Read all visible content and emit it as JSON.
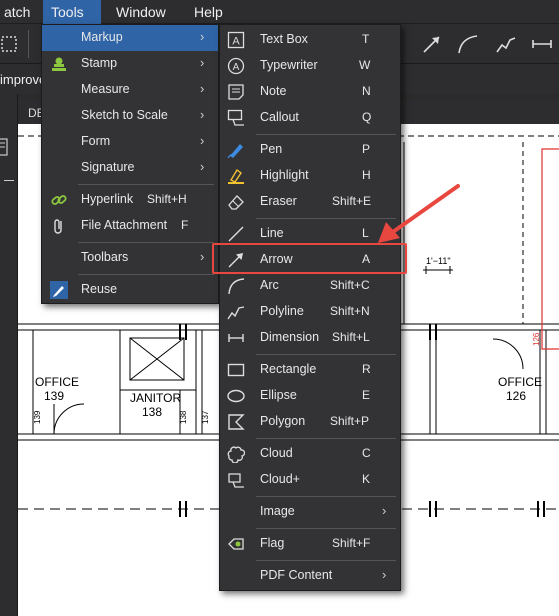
{
  "menubar": {
    "items": [
      {
        "label": "atch"
      },
      {
        "label": "Tools"
      },
      {
        "label": "Window"
      },
      {
        "label": "Help"
      }
    ]
  },
  "tab_text": "improvem",
  "doc_tab_text": "DE",
  "drawing": {
    "rooms": [
      {
        "name": "OFFICE",
        "number": "139"
      },
      {
        "name": "JANITOR",
        "number": "138"
      },
      {
        "name": "OFFICE",
        "number": "126"
      }
    ],
    "door_numbers": [
      "139",
      "138",
      "137",
      "126"
    ],
    "dimension": "1'−11\""
  },
  "tools_menu": {
    "items": [
      {
        "label": "Markup",
        "shortcut": "",
        "icon": "markup-icon",
        "submenu": true,
        "highlighted": true
      },
      {
        "label": "Stamp",
        "shortcut": "",
        "icon": "stamp-icon",
        "submenu": true
      },
      {
        "label": "Measure",
        "shortcut": "",
        "icon": "",
        "submenu": true
      },
      {
        "label": "Sketch to Scale",
        "shortcut": "",
        "icon": "",
        "submenu": true
      },
      {
        "label": "Form",
        "shortcut": "",
        "icon": "",
        "submenu": true
      },
      {
        "label": "Signature",
        "shortcut": "",
        "icon": "",
        "submenu": true
      },
      {
        "label": "Hyperlink",
        "shortcut": "Shift+H",
        "icon": "hyperlink-icon",
        "submenu": false
      },
      {
        "label": "File Attachment",
        "shortcut": "F",
        "icon": "paperclip-icon",
        "submenu": false
      },
      {
        "label": "Toolbars",
        "shortcut": "",
        "icon": "",
        "submenu": true
      },
      {
        "label": "Reuse",
        "shortcut": "",
        "icon": "reuse-icon",
        "submenu": false
      }
    ]
  },
  "markup_menu": {
    "items": [
      {
        "label": "Text Box",
        "shortcut": "T",
        "icon": "text-box-icon"
      },
      {
        "label": "Typewriter",
        "shortcut": "W",
        "icon": "typewriter-icon"
      },
      {
        "label": "Note",
        "shortcut": "N",
        "icon": "note-icon"
      },
      {
        "label": "Callout",
        "shortcut": "Q",
        "icon": "callout-icon"
      },
      {
        "label": "Pen",
        "shortcut": "P",
        "icon": "pen-icon"
      },
      {
        "label": "Highlight",
        "shortcut": "H",
        "icon": "highlight-icon"
      },
      {
        "label": "Eraser",
        "shortcut": "Shift+E",
        "icon": "eraser-icon"
      },
      {
        "label": "Line",
        "shortcut": "L",
        "icon": "line-icon"
      },
      {
        "label": "Arrow",
        "shortcut": "A",
        "icon": "arrow-icon"
      },
      {
        "label": "Arc",
        "shortcut": "Shift+C",
        "icon": "arc-icon"
      },
      {
        "label": "Polyline",
        "shortcut": "Shift+N",
        "icon": "polyline-icon"
      },
      {
        "label": "Dimension",
        "shortcut": "Shift+L",
        "icon": "dimension-icon"
      },
      {
        "label": "Rectangle",
        "shortcut": "R",
        "icon": "rectangle-icon"
      },
      {
        "label": "Ellipse",
        "shortcut": "E",
        "icon": "ellipse-icon"
      },
      {
        "label": "Polygon",
        "shortcut": "Shift+P",
        "icon": "polygon-icon"
      },
      {
        "label": "Cloud",
        "shortcut": "C",
        "icon": "cloud-icon"
      },
      {
        "label": "Cloud+",
        "shortcut": "K",
        "icon": "cloud-plus-icon"
      },
      {
        "label": "Image",
        "shortcut": "",
        "icon": "",
        "submenu": true
      },
      {
        "label": "Flag",
        "shortcut": "Shift+F",
        "icon": "flag-icon"
      },
      {
        "label": "PDF Content",
        "shortcut": "",
        "icon": "",
        "submenu": true
      }
    ]
  },
  "colors": {
    "highlight": "#2f64a6",
    "menu_bg": "#333336",
    "callout": "#e8473f",
    "plan_red": "#e03030"
  }
}
